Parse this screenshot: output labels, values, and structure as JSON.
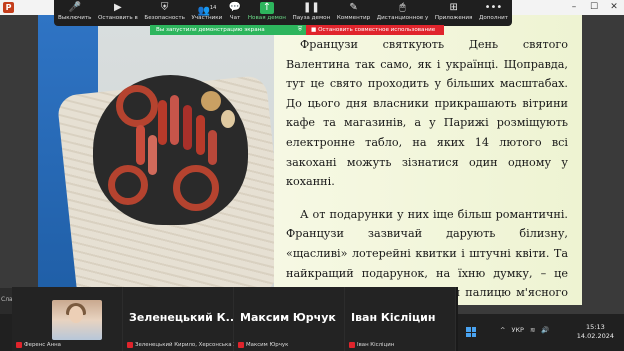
{
  "toolbar": {
    "items": [
      {
        "label": "Выключить",
        "icon": "microphone-icon"
      },
      {
        "label": "Остановить в",
        "icon": "video-camera-icon"
      },
      {
        "label": "Безопасность",
        "icon": "shield-icon"
      },
      {
        "label": "Участники",
        "icon": "participants-icon",
        "count": "14"
      },
      {
        "label": "Чат",
        "icon": "chat-icon"
      },
      {
        "label": "Новая демон",
        "icon": "share-screen-icon",
        "active": true
      },
      {
        "label": "Пауза демон",
        "icon": "pause-icon"
      },
      {
        "label": "Комментир",
        "icon": "annotate-icon"
      },
      {
        "label": "Дистанционное у",
        "icon": "remote-control-icon"
      },
      {
        "label": "Приложения",
        "icon": "apps-icon"
      },
      {
        "label": "Дополнит",
        "icon": "more-icon"
      }
    ]
  },
  "sharebar": {
    "status": "Вы запустили демонстрацию экрана",
    "stop": "Остановить совместное использование"
  },
  "slide": {
    "paragraphs": [
      "Французи святкують День святого Валентина так само, як і українці. Щоправда, тут це свято проходить у більших масштабах. До цього дня власники прикрашають вітрини кафе та магазинів, а у Парижі розміщують електронне табло, на яких 14 лютого всі закохані можуть зізнатися один одному у коханні.",
      "А от подарунки у них іще більш романтичні. Французи зазвичай дарують білизну, «щасливі» лотерейні квитки і штучні квіти. Та найкращий подарунок, на їхню думку, – це ковбаса. Та просто дарувати палицю м'ясного напівфабрикату не можна – її обов'язково потрібно нарізати у формі серця."
    ]
  },
  "participants": [
    {
      "name": "",
      "caption": "Ференс Анна",
      "has_video": true
    },
    {
      "name": "Зеленецький  К...",
      "caption": "Зеленецький Кирило, Херсонська З..."
    },
    {
      "name": "Максим Юрчук",
      "caption": "Максим Юрчук"
    },
    {
      "name": "Іван Кісліцин",
      "caption": "Іван Кісліцин"
    }
  ],
  "taskbar": {
    "left_text": "Слай",
    "language": "УКР",
    "time": "15:13",
    "date": "14.02.2024"
  }
}
